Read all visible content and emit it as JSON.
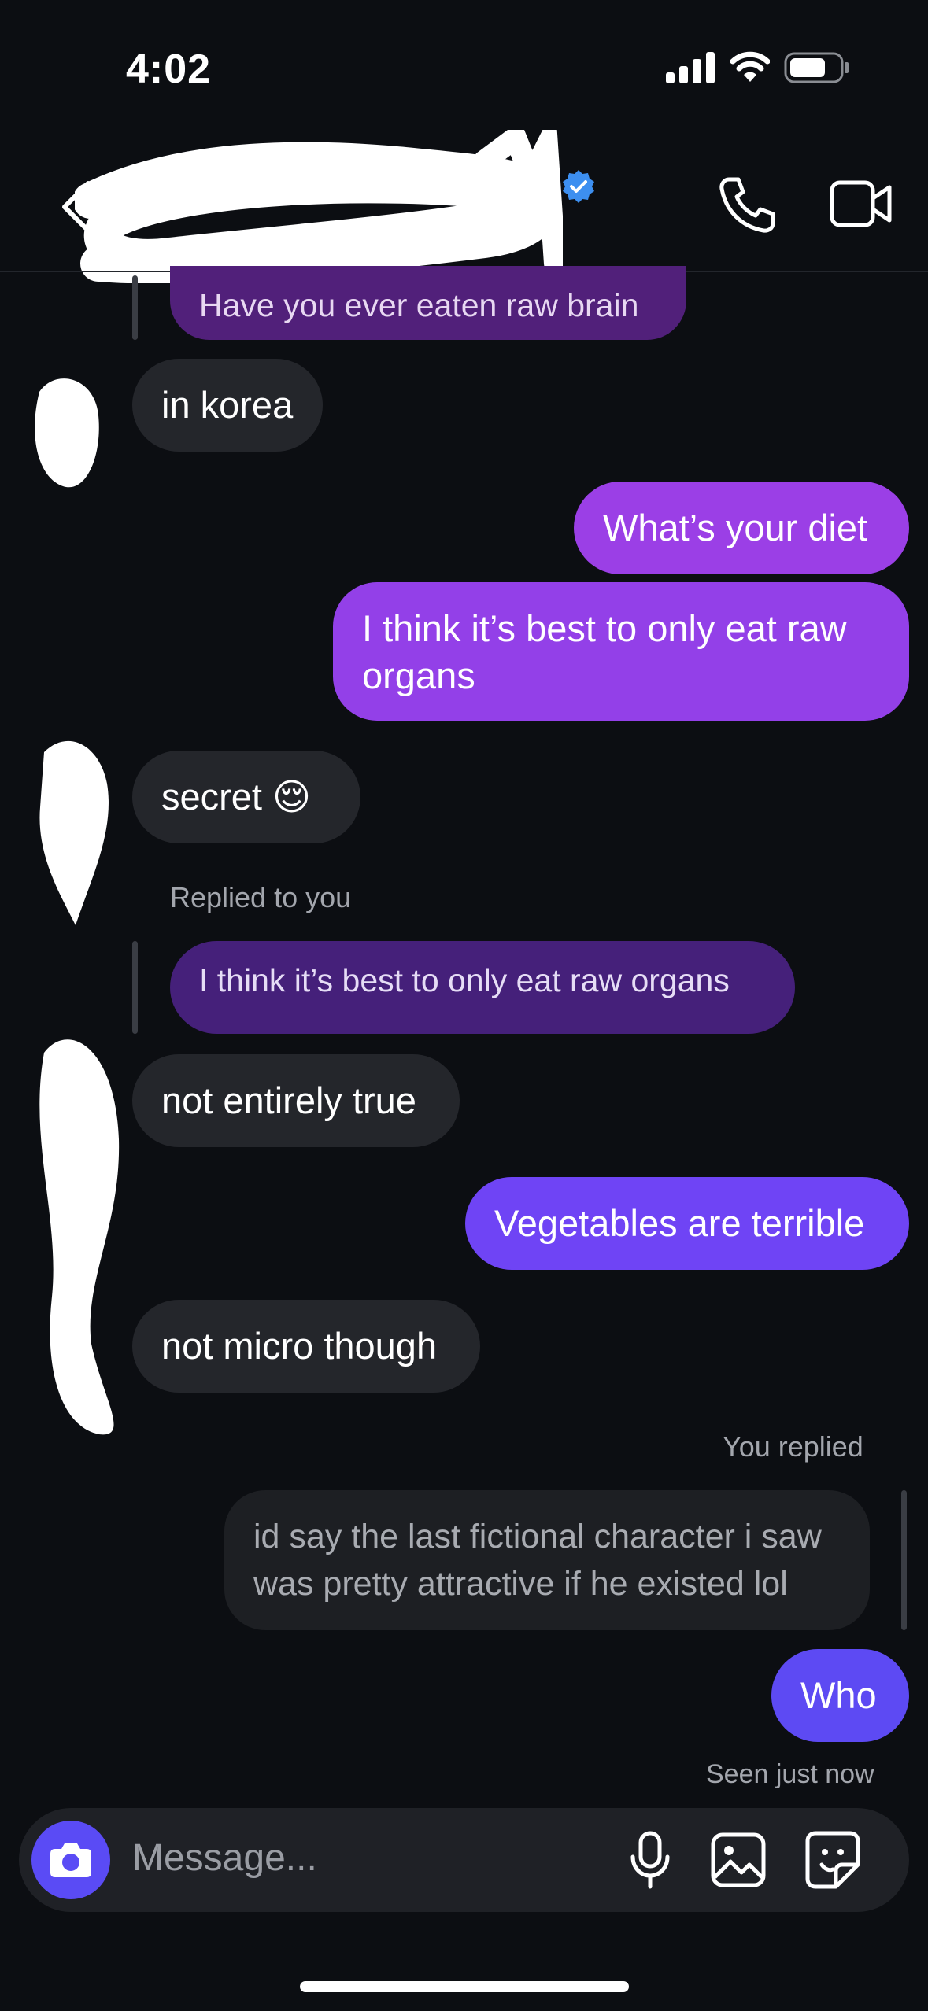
{
  "status_bar": {
    "time": "4:02"
  },
  "header": {
    "contact_name_redacted": true
  },
  "messages": {
    "top_quote": "Have you ever eaten raw brain",
    "in_1": "in korea",
    "out_1": "What’s your diet",
    "out_2_line1": "I think it’s best to only eat raw",
    "out_2_line2": "organs",
    "in_2": "secret 😌",
    "replied_label": "Replied to you",
    "reply_quote": "I think it’s best to only eat raw organs",
    "in_3": "not entirely true",
    "out_3": "Vegetables are terrible",
    "in_4": "not micro though",
    "you_replied_label": "You replied",
    "quoted_line1": "id say the last fictional character i saw",
    "quoted_line2": "was pretty attractive if he existed lol",
    "out_4": "Who",
    "seen": "Seen just now"
  },
  "composer": {
    "placeholder": "Message..."
  },
  "colors": {
    "background": "#0c0e12",
    "incoming": "#24262b",
    "outgoing_purple": "#9b3fe6",
    "outgoing_violet": "#6a45f5",
    "accent_camera": "#5a4bf5",
    "verified": "#3d8ff0"
  },
  "icons": [
    "back-icon",
    "verified-icon",
    "phone-icon",
    "video-icon",
    "camera-icon",
    "mic-icon",
    "gallery-icon",
    "sticker-icon"
  ]
}
